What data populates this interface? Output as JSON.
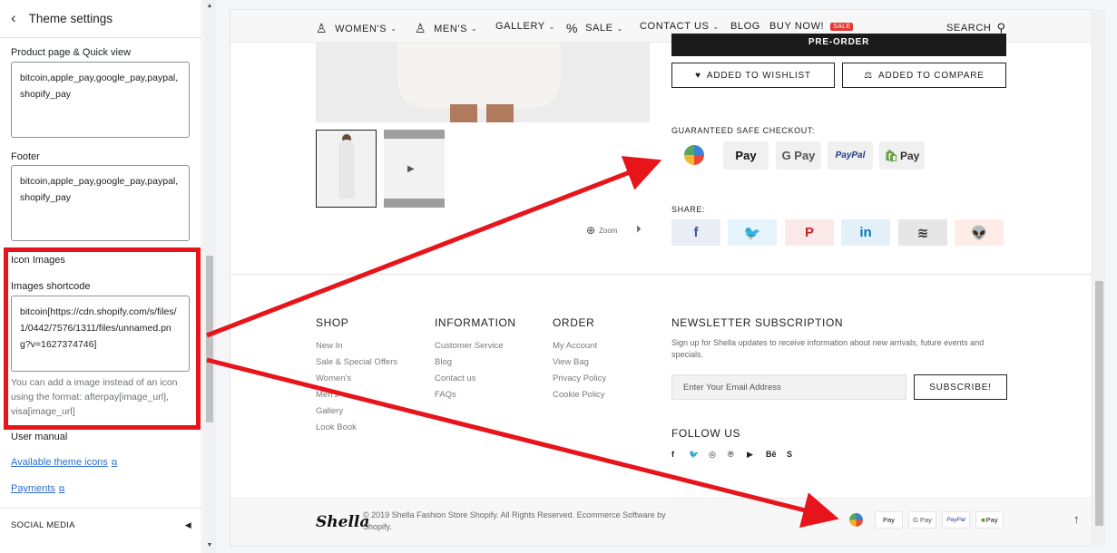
{
  "settings": {
    "title": "Theme settings",
    "product_label": "Product page & Quick view",
    "product_value": "bitcoin,apple_pay,google_pay,paypal,shopify_pay",
    "footer_label": "Footer",
    "footer_value": "bitcoin,apple_pay,google_pay,paypal,shopify_pay",
    "icon_images_heading": "Icon Images",
    "shortcode_label": "Images shortcode",
    "shortcode_value": "bitcoin[https://cdn.shopify.com/s/files/1/0442/7576/1311/files/unnamed.png?v=1627374746]",
    "help_text": "You can add a image instead of an icon using the format: afterpay[image_url], visa[image_url]",
    "user_manual_heading": "User manual",
    "link_theme_icons": "Available theme icons",
    "link_payments": "Payments",
    "social_media": "SOCIAL MEDIA"
  },
  "nav": {
    "women": "WOMEN'S",
    "men": "MEN'S",
    "gallery": "GALLERY",
    "sale": "SALE",
    "contact": "CONTACT US",
    "blog": "BLOG",
    "buy_now": "BUY NOW!",
    "buy_badge": "SALE",
    "search": "SEARCH"
  },
  "product": {
    "preorder": "PRE-ORDER",
    "wishlist": "ADDED TO WISHLIST",
    "compare": "ADDED TO COMPARE",
    "zoom": "Zoom",
    "checkout_heading": "GUARANTEED SAFE CHECKOUT:",
    "payments": [
      {
        "name": "bitcoin",
        "label": ""
      },
      {
        "name": "apple-pay",
        "label": "Pay"
      },
      {
        "name": "google-pay",
        "label": "G Pay"
      },
      {
        "name": "paypal",
        "label": "PayPal"
      },
      {
        "name": "shopify-pay",
        "label": "Pay"
      }
    ],
    "share_heading": "SHARE:",
    "share_icons": [
      "f",
      "🐦",
      "P",
      "in",
      "≋",
      "👽"
    ]
  },
  "footer": {
    "shop_heading": "SHOP",
    "shop_links": [
      "New In",
      "Sale & Special Offers",
      "Women's",
      "Men's",
      "Gallery",
      "Look Book"
    ],
    "info_heading": "INFORMATION",
    "info_links": [
      "Customer Service",
      "Blog",
      "Contact us",
      "FAQs"
    ],
    "order_heading": "ORDER",
    "order_links": [
      "My Account",
      "View Bag",
      "Privacy Policy",
      "Cookie Policy"
    ],
    "newsletter_heading": "NEWSLETTER SUBSCRIPTION",
    "newsletter_text": "Sign up for Shella updates to receive information about new arrivals, future events and specials.",
    "email_placeholder": "Enter Your Email Address",
    "subscribe": "SUBSCRIBE!",
    "follow_heading": "FOLLOW US",
    "social": [
      "f",
      "🐦",
      "◎",
      "℗",
      "▶",
      "Bē",
      "S"
    ],
    "logo": "Shella",
    "copyright": "© 2019 Shella Fashion Store Shopify. All Rights Reserved. Ecommerce Software by Shopify.",
    "mini_payments": [
      "Pay",
      "G Pay",
      "PayPal",
      "Pay"
    ]
  },
  "colors": {
    "annotation_red": "#e8141b",
    "link_blue": "#2c6ecb",
    "sale_red": "#e53935",
    "facebook": "#3b5998",
    "twitter": "#1da1f2",
    "pinterest": "#cb2027",
    "linkedin": "#0077b5",
    "reddit": "#ff4500"
  }
}
